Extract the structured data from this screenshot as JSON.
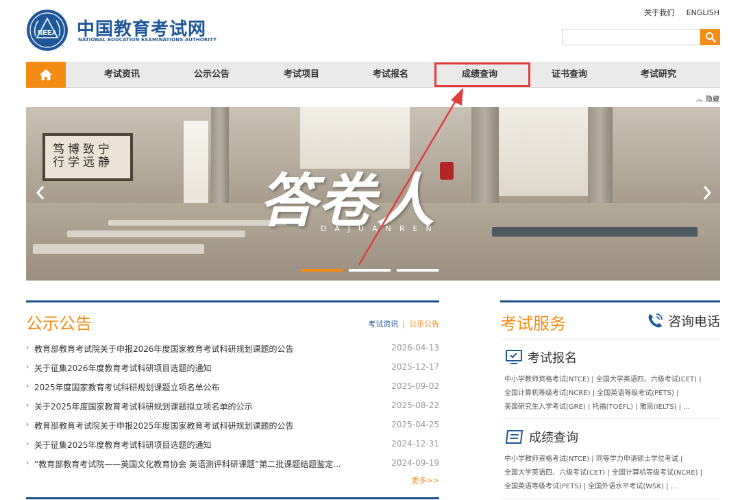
{
  "header": {
    "brand_cn": "中国教育考试网",
    "brand_en": "NATIONAL EDUCATION EXAMINATIONS AUTHORITY",
    "logo_text": "NEEA",
    "top_links": [
      "关于我们",
      "ENGLISH"
    ],
    "search_placeholder": ""
  },
  "nav": {
    "items": [
      "考试资讯",
      "公示公告",
      "考试项目",
      "考试报名",
      "成绩查询",
      "证书查询",
      "考试研究"
    ],
    "highlighted": "成绩查询"
  },
  "hide_label": "隐藏",
  "banner": {
    "title": "答卷人",
    "subtitle": "DAJUANREN",
    "scroll_text": "宁静致远 博学笃行",
    "active_slide": 1,
    "slide_count": 3,
    "colors": {
      "active": "#f28c12",
      "inactive": "#ffffff"
    }
  },
  "notice": {
    "title": "公示公告",
    "tabs": [
      "考试资讯",
      "公示公告"
    ],
    "items": [
      {
        "title": "教育部教育考试院关于申报2026年度国家教育考试科研规划课题的公告",
        "date": "2026-04-13"
      },
      {
        "title": "关于征集2026年度教育考试科研项目选题的通知",
        "date": "2025-12-17"
      },
      {
        "title": "2025年度国家教育考试科研规划课题立项名单公布",
        "date": "2025-09-02"
      },
      {
        "title": "关于2025年度国家教育考试科研规划课题拟立项名单的公示",
        "date": "2025-08-22"
      },
      {
        "title": "教育部教育考试院关于申报2025年度国家教育考试科研规划课题的公告",
        "date": "2025-04-25"
      },
      {
        "title": "关于征集2025年度教育考试科研项目选题的通知",
        "date": "2024-12-31"
      },
      {
        "title": "“教育部教育考试院——英国文化教育协会 英语测评科研课题”第二批课题结题鉴定...",
        "date": "2024-09-19"
      }
    ],
    "more": "更多>>"
  },
  "services": {
    "title": "考试服务",
    "phone": "咨询电话",
    "groups": [
      {
        "heading": "考试报名",
        "links": [
          "中小学教师资格考试(NTCE)",
          "全国大学英语四、六级考试(CET)",
          "全国计算机等级考试(NCRE)",
          "全国英语等级考试(PETS)",
          "美国研究生入学考试(GRE)",
          "托福(TOEFL)",
          "雅思(IELTS)",
          "..."
        ]
      },
      {
        "heading": "成绩查询",
        "links": [
          "中小学教师资格考试(NTCE)",
          "同等学力申请硕士学位考试",
          "全国大学英语四、六级考试(CET)",
          "全国计算机等级考试(NCRE)",
          "全国英语等级考试(PETS)",
          "全国外语水平考试(WSK)",
          "..."
        ]
      }
    ]
  },
  "colors": {
    "brand": "#1e5799",
    "accent": "#f28c12",
    "highlight": "#e03c3c",
    "bar": "#1e4f86"
  }
}
